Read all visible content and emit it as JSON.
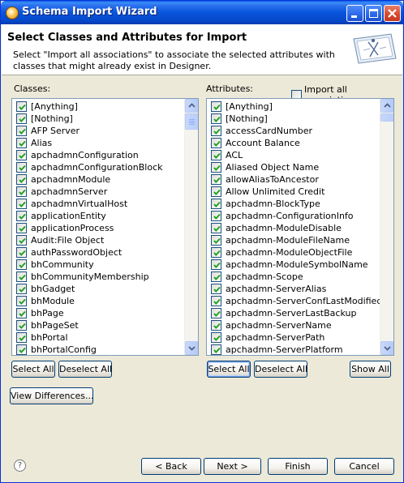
{
  "window": {
    "title": "Schema Import Wizard"
  },
  "header": {
    "title": "Select Classes and Attributes for Import",
    "description": "Select \"Import all associations\" to associate the selected attributes with classes that might already exist in Designer."
  },
  "classes": {
    "label": "Classes:",
    "items": [
      "[Anything]",
      "[Nothing]",
      "AFP Server",
      "Alias",
      "apchadmnConfiguration",
      "apchadmnConfigurationBlock",
      "apchadmnModule",
      "apchadmnServer",
      "apchadmnVirtualHost",
      "applicationEntity",
      "applicationProcess",
      "Audit:File Object",
      "authPasswordObject",
      "bhCommunity",
      "bhCommunityMembership",
      "bhGadget",
      "bhModule",
      "bhPage",
      "bhPageSet",
      "bhPortal",
      "bhPortalConfig"
    ],
    "select_all": "Select All",
    "deselect_all": "Deselect All"
  },
  "attributes": {
    "label": "Attributes:",
    "import_all_associations": "Import all associations",
    "import_all_checked": false,
    "items": [
      "[Anything]",
      "[Nothing]",
      "accessCardNumber",
      "Account Balance",
      "ACL",
      "Aliased Object Name",
      "allowAliasToAncestor",
      "Allow Unlimited Credit",
      "apchadmn-BlockType",
      "apchadmn-ConfigurationInfo",
      "apchadmn-ModuleDisable",
      "apchadmn-ModuleFileName",
      "apchadmn-ModuleObjectFile",
      "apchadmn-ModuleSymbolName",
      "apchadmn-Scope",
      "apchadmn-ServerAlias",
      "apchadmn-ServerConfLastModified",
      "apchadmn-ServerLastBackup",
      "apchadmn-ServerName",
      "apchadmn-ServerPath",
      "apchadmn-ServerPlatform"
    ],
    "select_all": "Select All",
    "deselect_all": "Deselect All",
    "show_all": "Show All"
  },
  "view_differences": "View Differences...",
  "footer": {
    "help": "?",
    "back": "< Back",
    "next": "Next >",
    "finish": "Finish",
    "cancel": "Cancel"
  },
  "colors": {
    "titlebar": "#0855DD",
    "dialog_bg": "#ECE9D8",
    "check": "#21A121"
  }
}
